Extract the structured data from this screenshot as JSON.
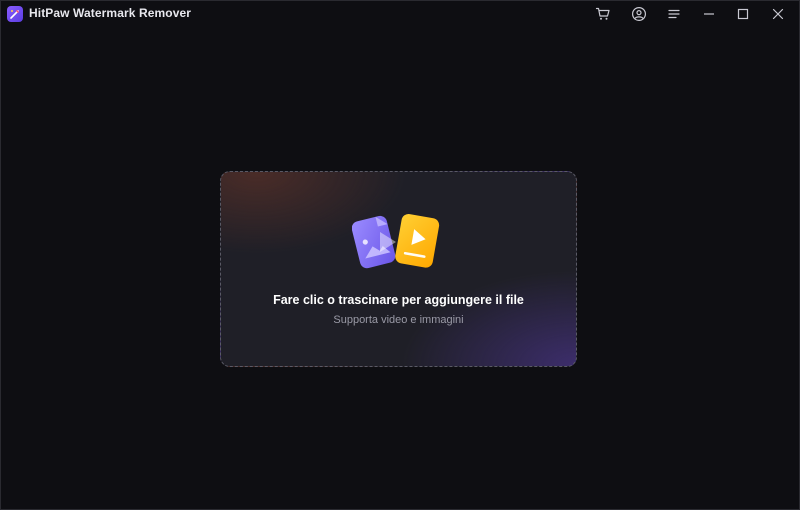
{
  "window": {
    "title": "HitPaw Watermark Remover"
  },
  "titlebar": {
    "icons": {
      "cart": "cart-icon",
      "account": "account-icon",
      "menu": "menu-icon",
      "minimize": "minimize-icon",
      "maximize": "maximize-icon",
      "close": "close-icon"
    }
  },
  "dropzone": {
    "title": "Fare clic o trascinare per aggiungere il file",
    "subtitle": "Supporta video e immagini",
    "icons": {
      "image_file": "image-file-icon",
      "video_file": "video-file-icon"
    }
  },
  "colors": {
    "background": "#0e0e12",
    "dropzone_bg": "#1f1f27",
    "dropzone_border": "#5a5a66",
    "accent_purple": "#7d6cf5",
    "accent_yellow": "#ffb400",
    "subtitle_text": "#9a9aa6"
  }
}
